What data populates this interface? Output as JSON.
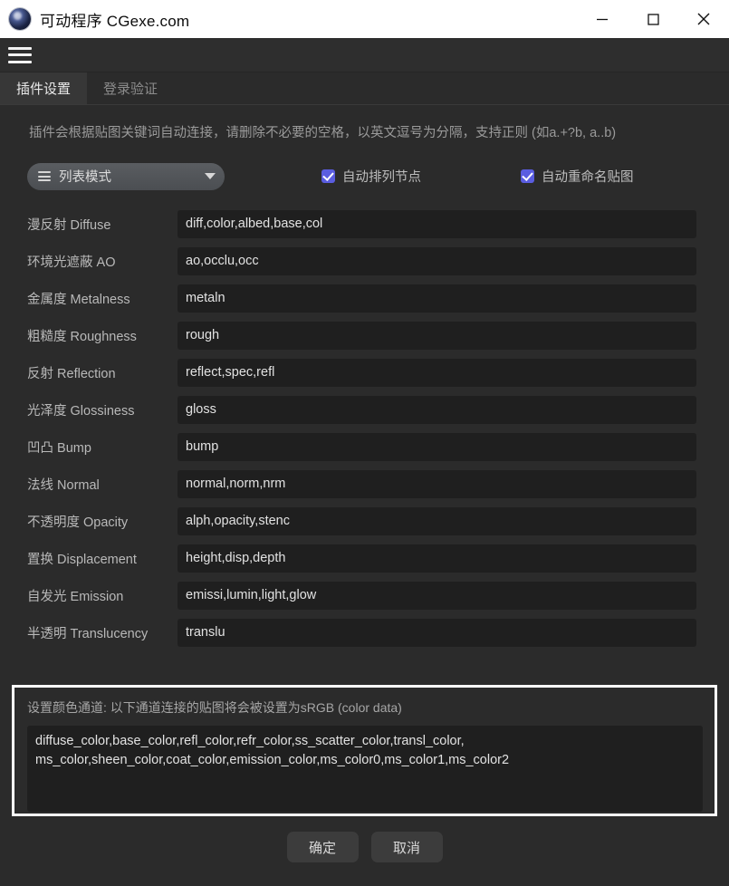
{
  "window": {
    "title": "可动程序 CGexe.com",
    "app_icon": "cinema4d-sphere-icon",
    "controls": {
      "minimize": "minimize-icon",
      "maximize": "maximize-icon",
      "close": "close-icon"
    }
  },
  "menu": {
    "hamburger": "hamburger-menu-icon"
  },
  "tabs": [
    {
      "label": "插件设置",
      "active": true
    },
    {
      "label": "登录验证",
      "active": false
    }
  ],
  "main": {
    "description": "插件会根据贴图关键词自动连接，请删除不必要的空格，以英文逗号为分隔，支持正则 (如a.+?b, a..b)",
    "list_mode": {
      "label": "列表模式",
      "icon": "list-icon",
      "caret": "chevron-down-icon"
    },
    "checkboxes": [
      {
        "label": "自动排列节点",
        "checked": true
      },
      {
        "label": "自动重命名贴图",
        "checked": true
      }
    ],
    "rows": [
      {
        "label": "漫反射 Diffuse",
        "value": "diff,color,albed,base,col"
      },
      {
        "label": "环境光遮蔽 AO",
        "value": "ao,occlu,occ"
      },
      {
        "label": "金属度 Metalness",
        "value": "metaln"
      },
      {
        "label": "粗糙度 Roughness",
        "value": "rough"
      },
      {
        "label": "反射 Reflection",
        "value": "reflect,spec,refl"
      },
      {
        "label": "光泽度 Glossiness",
        "value": "gloss"
      },
      {
        "label": "凹凸 Bump",
        "value": "bump"
      },
      {
        "label": "法线 Normal",
        "value": "normal,norm,nrm"
      },
      {
        "label": "不透明度 Opacity",
        "value": "alph,opacity,stenc"
      },
      {
        "label": "置换 Displacement",
        "value": "height,disp,depth"
      },
      {
        "label": "自发光 Emission",
        "value": "emissi,lumin,light,glow"
      },
      {
        "label": "半透明 Translucency",
        "value": "translu"
      }
    ],
    "srgb": {
      "title": "设置颜色通道: 以下通道连接的贴图将会被设置为sRGB (color data)",
      "value_line1": "diffuse_color,base_color,refl_color,refr_color,ss_scatter_color,transl_color,",
      "value_line2": "ms_color,sheen_color,coat_color,emission_color,ms_color0,ms_color1,ms_color2"
    }
  },
  "footer": {
    "confirm": "确定",
    "cancel": "取消"
  },
  "colors": {
    "window_bg": "#2b2b2b",
    "titlebar_bg": "#ffffff",
    "field_bg": "#1f1f1f",
    "accent_checkbox": "#5a5de0",
    "highlight_border": "#ffffff",
    "tab_active_bg": "#373737"
  }
}
